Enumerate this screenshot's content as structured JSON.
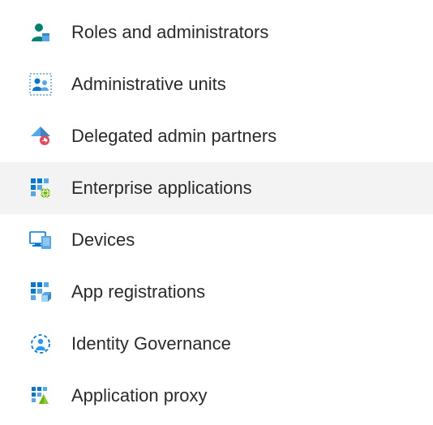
{
  "sidebar": {
    "items": [
      {
        "label": "Roles and administrators",
        "icon": "roles-icon",
        "selected": false
      },
      {
        "label": "Administrative units",
        "icon": "admin-units-icon",
        "selected": false
      },
      {
        "label": "Delegated admin partners",
        "icon": "delegated-partners-icon",
        "selected": false
      },
      {
        "label": "Enterprise applications",
        "icon": "enterprise-apps-icon",
        "selected": true
      },
      {
        "label": "Devices",
        "icon": "devices-icon",
        "selected": false
      },
      {
        "label": "App registrations",
        "icon": "app-registrations-icon",
        "selected": false
      },
      {
        "label": "Identity Governance",
        "icon": "identity-governance-icon",
        "selected": false
      },
      {
        "label": "Application proxy",
        "icon": "application-proxy-icon",
        "selected": false
      }
    ]
  },
  "colors": {
    "accent_blue": "#0078d4",
    "teal": "#008272",
    "green": "#6bb700"
  }
}
